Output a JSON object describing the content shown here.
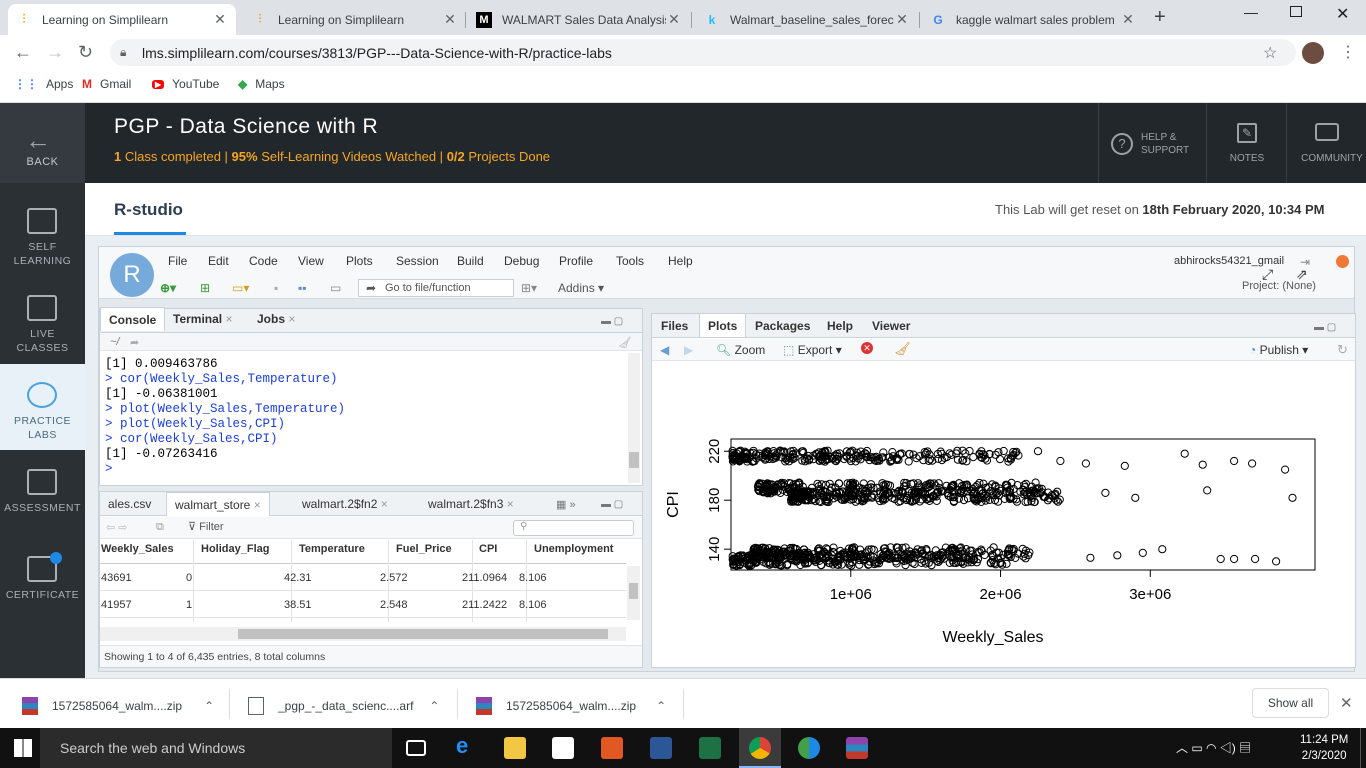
{
  "browser": {
    "tabs": [
      {
        "title": "Learning on Simplilearn",
        "active": true
      },
      {
        "title": "Learning on Simplilearn",
        "active": false
      },
      {
        "title": "WALMART Sales Data Analysis",
        "active": false
      },
      {
        "title": "Walmart_baseline_sales_foreca",
        "active": false
      },
      {
        "title": "kaggle walmart sales problem",
        "active": false
      }
    ],
    "url": "lms.simplilearn.com/courses/3813/PGP---Data-Science-with-R/practice-labs",
    "bookmarks": [
      "Apps",
      "Gmail",
      "YouTube",
      "Maps"
    ]
  },
  "header": {
    "back_label": "BACK",
    "course_title": "PGP - Data Science with R",
    "status": {
      "classes_num": "1",
      "classes_text": " Class completed | ",
      "videos_num": "95%",
      "videos_text": " Self-Learning Videos Watched  | ",
      "projects_num": "0/2",
      "projects_text": " Projects Done"
    },
    "help_label_1": "HELP &",
    "help_label_2": "SUPPORT",
    "notes_label": "NOTES",
    "community_label": "COMMUNITY"
  },
  "leftnav": [
    {
      "line1": "SELF",
      "line2": "LEARNING"
    },
    {
      "line1": "LIVE",
      "line2": "CLASSES"
    },
    {
      "line1": "PRACTICE",
      "line2": "LABS"
    },
    {
      "line1": "ASSESSMENT",
      "line2": ""
    },
    {
      "line1": "CERTIFICATE",
      "line2": ""
    }
  ],
  "lab": {
    "title": "R-studio",
    "reset_prefix": "This Lab will get reset on ",
    "reset_date": "18th February 2020, 10:34 PM"
  },
  "rstudio": {
    "logo": "R",
    "menu": [
      "File",
      "Edit",
      "Code",
      "View",
      "Plots",
      "Session",
      "Build",
      "Debug",
      "Profile",
      "Tools",
      "Help"
    ],
    "goto_placeholder": "Go to file/function",
    "addins_label": "Addins",
    "user": "abhirocks54321_gmail",
    "project": "Project: (None)",
    "console_tabs": [
      "Console",
      "Terminal",
      "Jobs"
    ],
    "console_path": "~/",
    "console_lines": [
      {
        "text": "[1] 0.009463786",
        "type": "out"
      },
      {
        "text": "> cor(Weekly_Sales,Temperature)",
        "type": "cmd"
      },
      {
        "text": "[1] -0.06381001",
        "type": "out"
      },
      {
        "text": "> plot(Weekly_Sales,Temperature)",
        "type": "cmd"
      },
      {
        "text": "> plot(Weekly_Sales,CPI)",
        "type": "cmd"
      },
      {
        "text": "> cor(Weekly_Sales,CPI)",
        "type": "cmd"
      },
      {
        "text": "[1] -0.07263416",
        "type": "out"
      },
      {
        "text": ">",
        "type": "cmd"
      }
    ],
    "data_tabs": [
      "ales.csv",
      "walmart_store",
      "walmart.2$fn2",
      "walmart.2$fn3"
    ],
    "filter_label": "Filter",
    "columns": [
      "Weekly_Sales",
      "Holiday_Flag",
      "Temperature",
      "Fuel_Price",
      "CPI",
      "Unemployment"
    ],
    "rows": [
      [
        "43691",
        "0",
        "42.31",
        "2.572",
        "211.0964",
        "8.106"
      ],
      [
        "41957",
        "1",
        "38.51",
        "2.548",
        "211.2422",
        "8.106"
      ]
    ],
    "table_footer": "Showing 1 to 4 of 6,435 entries, 8 total columns",
    "right_tabs": [
      "Files",
      "Plots",
      "Packages",
      "Help",
      "Viewer"
    ],
    "plot_toolbar": {
      "zoom": "Zoom",
      "export": "Export",
      "publish": "Publish"
    }
  },
  "chart_data": {
    "type": "scatter",
    "xlabel": "Weekly_Sales",
    "ylabel": "CPI",
    "x_ticks": [
      "1e+06",
      "2e+06",
      "3e+06"
    ],
    "y_ticks": [
      "140",
      "180",
      "220"
    ],
    "xlim": [
      200000,
      4100000
    ],
    "ylim": [
      123,
      230
    ],
    "bands": [
      {
        "y_center": 216,
        "x_from": 210000,
        "x_to": 2200000
      },
      {
        "y_center": 190,
        "x_from": 380000,
        "x_to": 2300000
      },
      {
        "y_center": 183,
        "x_from": 600000,
        "x_to": 2400000
      },
      {
        "y_center": 137,
        "x_from": 350000,
        "x_to": 2200000
      },
      {
        "y_center": 131,
        "x_from": 210000,
        "x_to": 2100000
      }
    ],
    "outliers": [
      [
        2250000,
        220
      ],
      [
        2400000,
        212
      ],
      [
        2570000,
        210
      ],
      [
        2830000,
        208
      ],
      [
        3230000,
        218
      ],
      [
        3350000,
        209
      ],
      [
        3560000,
        212
      ],
      [
        3680000,
        210
      ],
      [
        3900000,
        205
      ],
      [
        3950000,
        182
      ],
      [
        3380000,
        188
      ],
      [
        2900000,
        182
      ],
      [
        2700000,
        186
      ],
      [
        3470000,
        132
      ],
      [
        3560000,
        132
      ],
      [
        3700000,
        132
      ],
      [
        3840000,
        130
      ],
      [
        2780000,
        135
      ],
      [
        2950000,
        137
      ],
      [
        3080000,
        140
      ],
      [
        2600000,
        133
      ]
    ]
  },
  "downloads": [
    {
      "name": "1572585064_walm....zip"
    },
    {
      "name": "_pgp_-_data_scienc....arf"
    },
    {
      "name": "1572585064_walm....zip"
    }
  ],
  "downloads_showall": "Show all",
  "taskbar": {
    "search_placeholder": "Search the web and Windows",
    "time": "11:24 PM",
    "date": "2/3/2020"
  }
}
